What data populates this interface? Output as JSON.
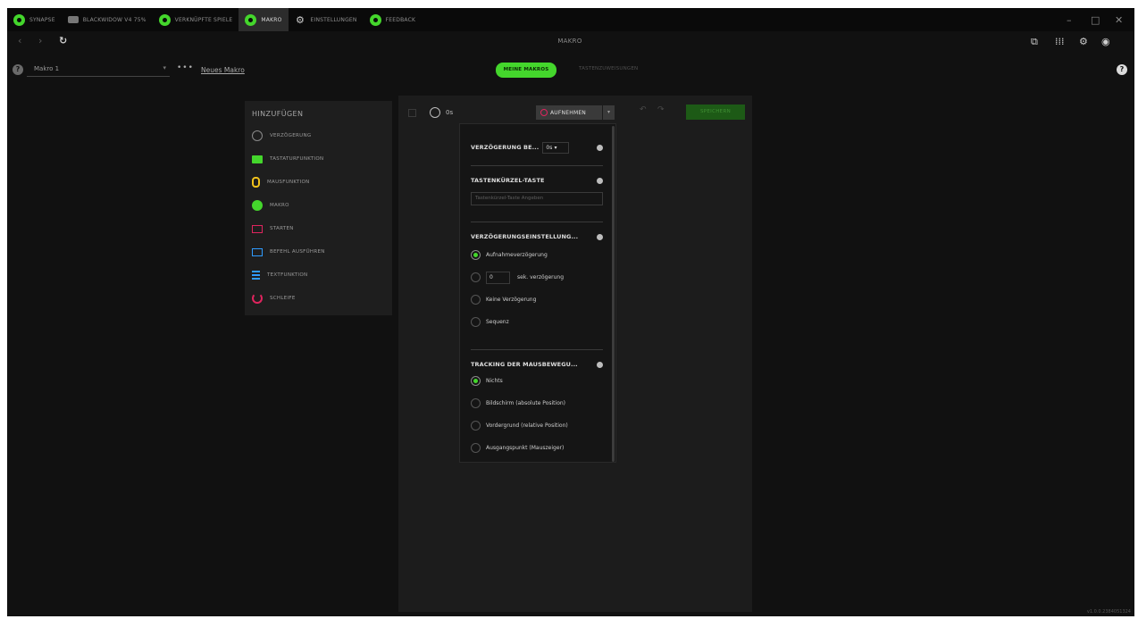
{
  "topbar": {
    "tabs": [
      {
        "label": "SYNAPSE",
        "icon": "razer-logo-icon",
        "active": false
      },
      {
        "label": "BLACKWIDOW V4 75%",
        "icon": "keyboard-icon",
        "active": false
      },
      {
        "label": "VERKNÜPFTE SPIELE",
        "icon": "gamepad-icon",
        "active": false
      },
      {
        "label": "MAKRO",
        "icon": "macro-icon",
        "active": true
      },
      {
        "label": "EINSTELLUNGEN",
        "icon": "gear-icon",
        "active": false
      },
      {
        "label": "FEEDBACK",
        "icon": "feedback-icon",
        "active": false
      }
    ]
  },
  "navbar": {
    "title": "MAKRO"
  },
  "macrobar": {
    "selected_macro": "Makro 1",
    "new_macro_label": "Neues Makro",
    "my_macros_label": "MEINE MAKROS",
    "assign_label": "TASTENZUWEISUNGEN"
  },
  "add_panel": {
    "title": "HINZUFÜGEN",
    "items": [
      {
        "label": "VERZÖGERUNG",
        "icon": "clock-icon"
      },
      {
        "label": "TASTATURFUNKTION",
        "icon": "keyboard-icon"
      },
      {
        "label": "MAUSFUNKTION",
        "icon": "mouse-icon"
      },
      {
        "label": "MAKRO",
        "icon": "macro-icon"
      },
      {
        "label": "STARTEN",
        "icon": "launch-icon"
      },
      {
        "label": "BEFEHL AUSFÜHREN",
        "icon": "command-icon"
      },
      {
        "label": "TEXTFUNKTION",
        "icon": "text-icon"
      },
      {
        "label": "SCHLEIFE",
        "icon": "loop-icon"
      }
    ]
  },
  "editor": {
    "total_time": "0s",
    "record_label": "AUFNEHMEN",
    "save_label": "SPEICHERN"
  },
  "settings": {
    "delay_label": "VERZÖGERUNG BE...",
    "delay_value": "0s",
    "hotkey_label": "TASTENKÜRZEL-TASTE",
    "hotkey_placeholder": "Tastenkürzel-Taste Angeben",
    "delay_settings_label": "VERZÖGERUNGSEINSTELLUNG...",
    "delay_options": [
      {
        "label": "Aufnahmeverzögerung",
        "selected": true
      },
      {
        "label": "sek. verzögerung",
        "selected": false,
        "input_value": "0"
      },
      {
        "label": "Keine Verzögerung",
        "selected": false
      },
      {
        "label": "Sequenz",
        "selected": false
      }
    ],
    "tracking_label": "TRACKING DER MAUSBEWEGU...",
    "tracking_options": [
      {
        "label": "Nichts",
        "selected": true
      },
      {
        "label": "Bildschirm (absolute Position)",
        "selected": false
      },
      {
        "label": "Vordergrund (relative Position)",
        "selected": false
      },
      {
        "label": "Ausgangspunkt (Mauszeiger)",
        "selected": false
      }
    ]
  },
  "colors": {
    "accent": "#44d62c",
    "record": "#e0245e",
    "background": "#111111",
    "panel": "#1e1e1e"
  },
  "version": "v1.0.0.2384051324"
}
